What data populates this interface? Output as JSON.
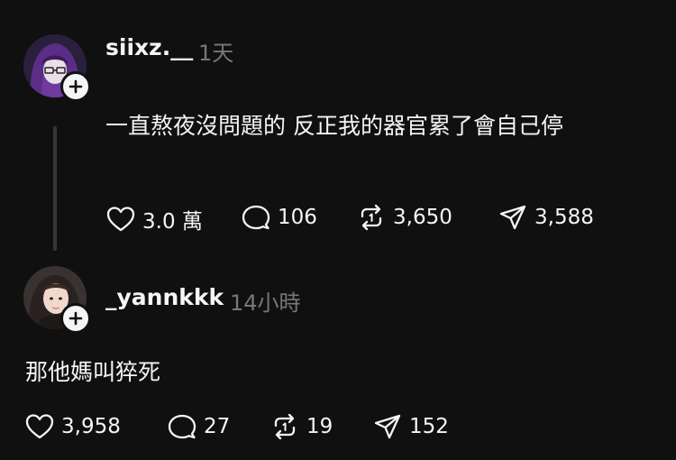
{
  "posts": [
    {
      "username": "siixz.__",
      "time": "1天",
      "text": "一直熬夜沒問題的 反正我的器官累了會自己停",
      "likes": "3.0 萬",
      "replies": "106",
      "reposts": "3,650",
      "shares": "3,588"
    },
    {
      "username": "_yannkkk",
      "time": "14小時",
      "text": "那他媽叫猝死",
      "likes": "3,958",
      "replies": "27",
      "reposts": "19",
      "shares": "152"
    }
  ],
  "icons": {
    "like": "heart-icon",
    "reply": "comment-bubble-icon",
    "repost": "repost-icon",
    "share": "send-icon",
    "follow": "plus-icon"
  },
  "colors": {
    "background": "#101010",
    "text": "#f3f5f7",
    "muted": "#777777",
    "thread_line": "#333638"
  }
}
